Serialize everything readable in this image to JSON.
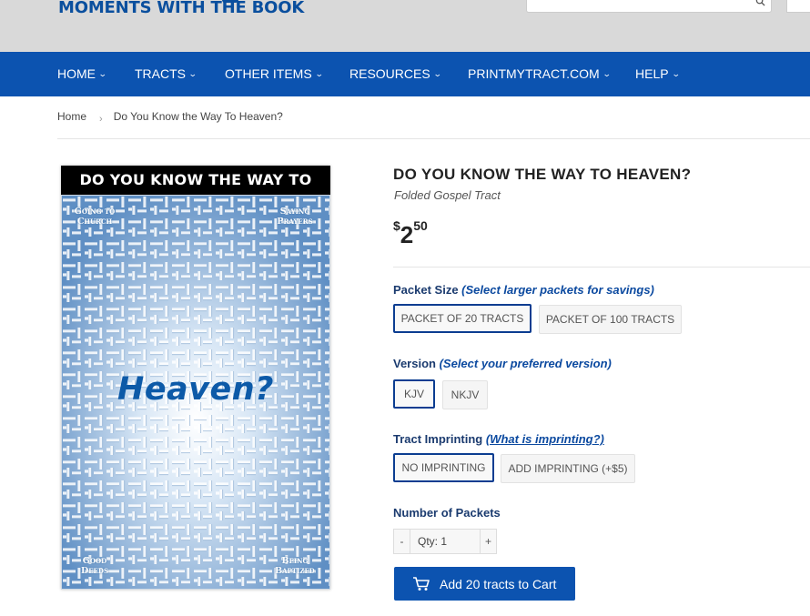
{
  "header": {
    "logo_text": "MOMENTS WITH THE BOOK"
  },
  "nav": {
    "items": [
      {
        "label": "HOME"
      },
      {
        "label": "TRACTS"
      },
      {
        "label": "OTHER ITEMS"
      },
      {
        "label": "RESOURCES"
      },
      {
        "label": "PRINTMYTRACT.COM"
      },
      {
        "label": "HELP"
      }
    ]
  },
  "breadcrumb": {
    "home": "Home",
    "separator": "›",
    "current": "Do You Know the Way To Heaven?"
  },
  "product_image": {
    "band_text": "DO YOU KNOW THE WAY TO",
    "center_text": "Heaven?",
    "corners": {
      "top_left": "Going to Church",
      "top_right": "Saying Prayers",
      "bottom_left": "Good Deeds",
      "bottom_right": "Being Baptized"
    }
  },
  "product": {
    "title": "DO YOU KNOW THE WAY TO HEAVEN?",
    "subtitle": "Folded Gospel Tract",
    "price_currency": "$",
    "price_dollars": "2",
    "price_cents": "50"
  },
  "options": {
    "packet_size": {
      "label": "Packet Size",
      "hint": "(Select larger packets for savings)",
      "values": [
        "PACKET OF 20 TRACTS",
        "PACKET OF 100 TRACTS"
      ],
      "selected": "PACKET OF 20 TRACTS"
    },
    "version": {
      "label": "Version",
      "hint": "(Select your preferred version)",
      "values": [
        "KJV",
        "NKJV"
      ],
      "selected": "KJV"
    },
    "imprinting": {
      "label": "Tract Imprinting",
      "link": "(What is imprinting?)",
      "values": [
        "NO IMPRINTING",
        "ADD IMPRINTING (+$5)"
      ],
      "selected": "NO IMPRINTING"
    }
  },
  "quantity": {
    "label": "Number of Packets",
    "minus": "-",
    "plus": "+",
    "value": "Qty: 1"
  },
  "cart": {
    "button_label": "Add 20 tracts to Cart"
  },
  "colors": {
    "brand_blue": "#0c53b0",
    "selected_border": "#0b3d91",
    "header_gray": "#d9d9d9"
  }
}
